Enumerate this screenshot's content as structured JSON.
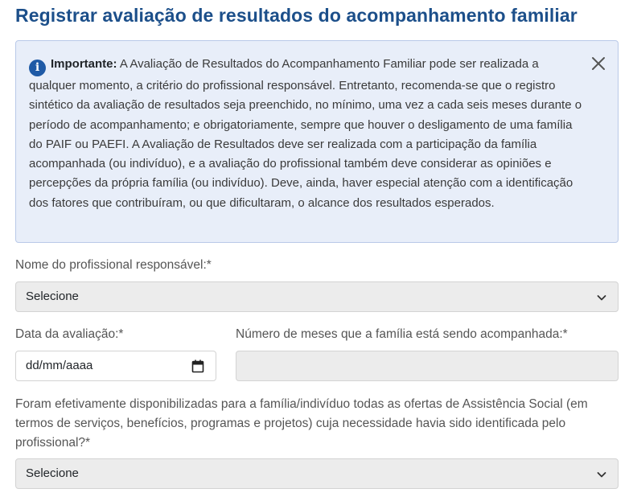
{
  "page": {
    "title": "Registrar avaliação de resultados do acompanhamento familiar"
  },
  "alert": {
    "icon": "info-icon",
    "strong": "Importante:",
    "text": " A Avaliação de Resultados do Acompanhamento Familiar pode ser realizada a qualquer momento, a critério do profissional responsável. Entretanto, recomenda-se que o registro sintético da avaliação de resultados seja preenchido, no mínimo, uma vez a cada seis meses durante o período de acompanhamento; e obrigatoriamente, sempre que houver o desligamento de uma família do PAIF ou PAEFI. A Avaliação de Resultados deve ser realizada com a participação da família acompanhada (ou indivíduo), e a avaliação do profissional também deve considerar as opiniões e percepções da própria família (ou indivíduo). Deve, ainda, haver especial atenção com a identificação dos fatores que contribuíram, ou que dificultaram, o alcance dos resultados esperados.",
    "close_icon": "close-icon",
    "background": "#e8eef9"
  },
  "form": {
    "professional": {
      "label": "Nome do profissional responsável:*",
      "value": "Selecione"
    },
    "evaluation_date": {
      "label": "Data da avaliação:*",
      "value": "dd/mm/aaaa"
    },
    "months": {
      "label": "Número de meses que a família está sendo acompanhada:*",
      "value": ""
    },
    "offers": {
      "label": "Foram efetivamente disponibilizadas para a família/indivíduo todas as ofertas de Assistência Social (em termos de serviços, benefícios, programas e projetos) cuja necessidade havia sido identificada pelo profissional?*",
      "value": "Selecione"
    }
  },
  "colors": {
    "title": "#1c4f8a",
    "field_background": "#ececec"
  }
}
